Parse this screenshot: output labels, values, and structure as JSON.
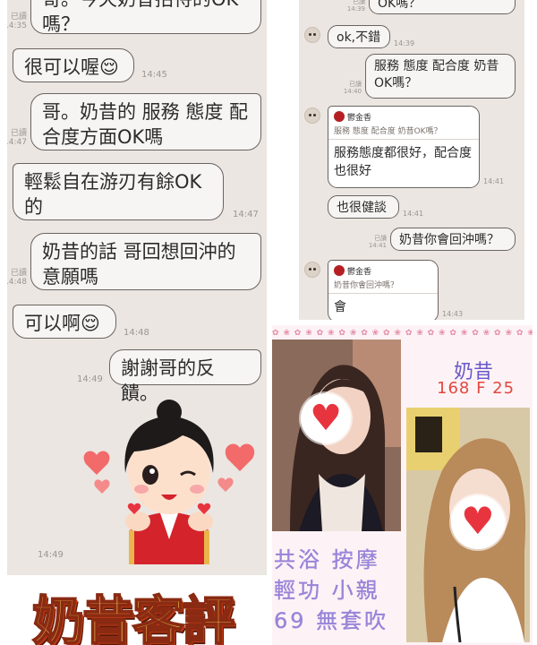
{
  "left_chat": {
    "messages": [
      {
        "text": "哥。今天奶昔招待的OK嗎？",
        "read": "已讀",
        "time": "14:35",
        "side": "right"
      },
      {
        "text": "很可以喔😌",
        "time": "14:45",
        "side": "left"
      },
      {
        "text": "哥。奶昔的 服務 態度 配合度方面OK嗎",
        "read": "已讀",
        "time": "14:47",
        "side": "right"
      },
      {
        "text": "輕鬆自在游刃有餘OK的",
        "time": "14:47",
        "side": "left"
      },
      {
        "text": "奶昔的話 哥回想回沖的意願嗎",
        "read": "已讀",
        "time": "14:48",
        "side": "right"
      },
      {
        "text": "可以啊😌",
        "time": "14:48",
        "side": "left"
      },
      {
        "text": "謝謝哥的反饋。",
        "time": "14:49",
        "side": "right"
      }
    ],
    "sticker_time": "14:49"
  },
  "right_chat": {
    "messages": [
      {
        "text": "OK嗎？",
        "read": "已讀",
        "time": "14:39"
      },
      {
        "text": "ok,不錯",
        "time": "14:39"
      },
      {
        "text": "服務 態度 配合度 奶昔OK嗎？",
        "read": "已讀",
        "time": "14:40"
      },
      {
        "quote_name": "鬱金香",
        "quote_text": "服務 態度 配合度 奶昔OK嗎？",
        "text": "服務態度都很好，配合度也很好",
        "time": "14:41"
      },
      {
        "text": "也很健談",
        "time": "14:41"
      },
      {
        "text": "奶昔你會回沖嗎？",
        "read": "已讀",
        "time": "14:41"
      },
      {
        "quote_name": "鬱金香",
        "quote_text": "奶昔你會回沖嗎？",
        "text": "會",
        "time": "14:43"
      }
    ]
  },
  "profile": {
    "name": "奶昔",
    "stats": "168 F 25",
    "services_line1": "共浴 按摩",
    "services_line2": "輕功 小親",
    "services_line3": "69 無套吹",
    "heart_icon": "♥"
  },
  "banner": {
    "text": "奶昔客評"
  },
  "colors": {
    "chat_bg": "#ebe6e1",
    "bubble_border": "#6b6461",
    "name_color": "#6a58c9",
    "stats_color": "#e4463e",
    "banner_fill": "#f7d25a"
  }
}
